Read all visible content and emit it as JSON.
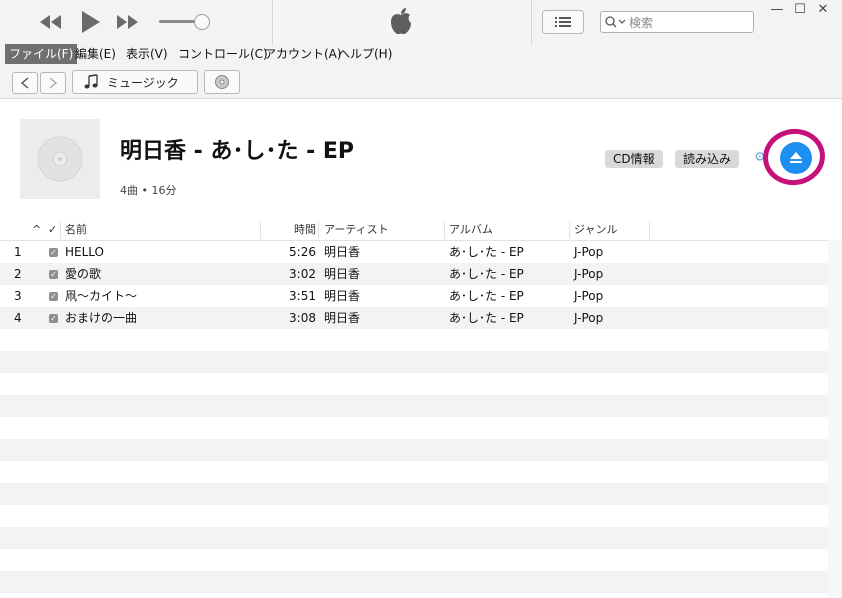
{
  "player": {
    "icons": [
      "rewind-icon",
      "play-icon",
      "fast-forward-icon",
      "volume-slider",
      "apple-logo-icon",
      "list-view-icon",
      "search-icon"
    ]
  },
  "search": {
    "placeholder": "検索"
  },
  "menu": [
    "ファイル(F)",
    "編集(E)",
    "表示(V)",
    "コントロール(C)",
    "アカウント(A)",
    "ヘルプ(H)"
  ],
  "nav": {
    "media_label": "ミュージック"
  },
  "album": {
    "title": "明日香 - あ･し･た - EP",
    "subtitle": "4曲 • 16分",
    "cd_info_label": "CD情報",
    "import_label": "読み込み"
  },
  "table": {
    "headers": {
      "sort": "^",
      "check": "✓",
      "name": "名前",
      "time": "時間",
      "artist": "アーティスト",
      "album": "アルバム",
      "genre": "ジャンル"
    },
    "rows": [
      {
        "num": "1",
        "name": "HELLO",
        "time": "5:26",
        "artist": "明日香",
        "album": "あ･し･た - EP",
        "genre": "J-Pop"
      },
      {
        "num": "2",
        "name": "愛の歌",
        "time": "3:02",
        "artist": "明日香",
        "album": "あ･し･た - EP",
        "genre": "J-Pop"
      },
      {
        "num": "3",
        "name": "凧～カイト～",
        "time": "3:51",
        "artist": "明日香",
        "album": "あ･し･た - EP",
        "genre": "J-Pop"
      },
      {
        "num": "4",
        "name": "おまけの一曲",
        "time": "3:08",
        "artist": "明日香",
        "album": "あ･し･た - EP",
        "genre": "J-Pop"
      }
    ]
  },
  "colors": {
    "accent": "#1e8ef0",
    "highlight_ring": "#c6117a",
    "menu_selected": "#6f6f6f"
  }
}
